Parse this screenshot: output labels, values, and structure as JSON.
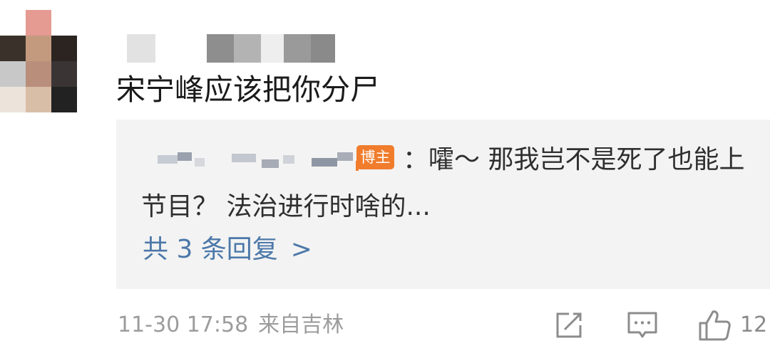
{
  "comment": {
    "text": "宋宁峰应该把你分尸",
    "timestamp": "11-30 17:58",
    "location": "来自吉林",
    "like_count": "12"
  },
  "reply": {
    "badge": "博主",
    "text": "：嚯～ 那我岂不是死了也能上节目？ 法治进行时啥的...",
    "more_label": "共 3 条回复",
    "more_chevron": ">"
  },
  "icons": {
    "share": "share-icon",
    "comment": "comment-icon",
    "like": "thumbs-up-icon"
  },
  "colors": {
    "link_blue": "#4c78a9",
    "badge_orange": "#f07c2c",
    "reply_bg": "#f3f3f3",
    "meta_gray": "#9c9c9c"
  }
}
